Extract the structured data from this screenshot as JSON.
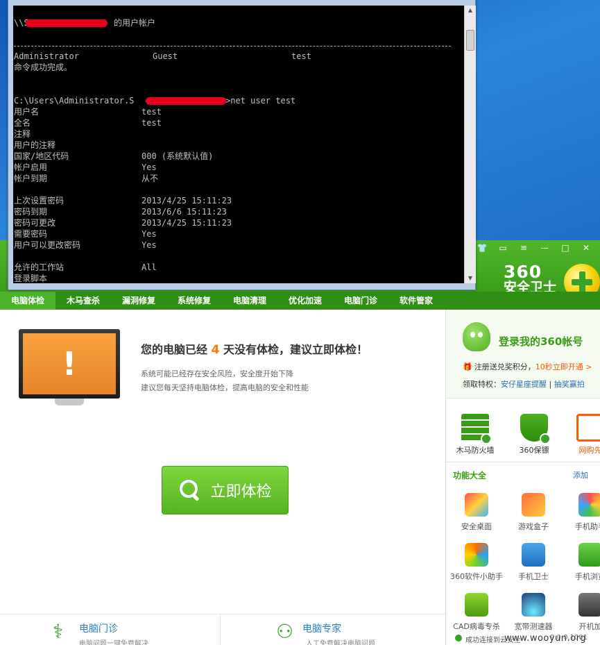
{
  "cmd": {
    "header_user_title": "的用户帐户",
    "header_prefix": "\\\\S",
    "users": [
      "Administrator",
      "Guest",
      "test"
    ],
    "success": "命令成功完成。",
    "prompt_prefix": "C:\\Users\\Administrator.S",
    "prompt_cmd": ">net user test",
    "rows": [
      {
        "label": "用户名",
        "value": "test"
      },
      {
        "label": "全名",
        "value": "test"
      },
      {
        "label": "注释",
        "value": ""
      },
      {
        "label": "用户的注释",
        "value": ""
      },
      {
        "label": "国家/地区代码",
        "value": "000 (系统默认值)"
      },
      {
        "label": "帐户启用",
        "value": "Yes"
      },
      {
        "label": "帐户到期",
        "value": "从不"
      },
      {
        "label": "上次设置密码",
        "value": "2013/4/25 15:11:23"
      },
      {
        "label": "密码到期",
        "value": "2013/6/6 15:11:23"
      },
      {
        "label": "密码可更改",
        "value": "2013/4/25 15:11:23"
      },
      {
        "label": "需要密码",
        "value": "Yes"
      },
      {
        "label": "用户可以更改密码",
        "value": "Yes"
      },
      {
        "label": "允许的工作站",
        "value": "All"
      },
      {
        "label": "登录脚本",
        "value": ""
      }
    ]
  },
  "app360": {
    "brand_num": "360",
    "brand_name": "安全卫士",
    "tabs": [
      "电脑体检",
      "木马查杀",
      "漏洞修复",
      "系统修复",
      "电脑清理",
      "优化加速",
      "电脑门诊",
      "软件管家"
    ],
    "headline_before": "您的电脑已经 ",
    "headline_days": "4",
    "headline_after": " 天没有体检，建议立即体检！",
    "sub1": "系统可能已经存在安全风险，安全度开始下降",
    "sub2": "建议您每天坚持电脑体检，提高电脑的安全和性能",
    "check_button": "立即体检",
    "bottom_left_title": "电脑门诊",
    "bottom_left_sub": "电脑问题一键免费解决",
    "bottom_right_title": "电脑专家",
    "bottom_right_sub": "人工免费解决电脑问题"
  },
  "rpanel": {
    "login_title": "登录我的360帐号",
    "promo_text": "注册送兑奖积分，",
    "promo_red": "10秒立即开通 >",
    "priv_label": "领取特权：",
    "priv_link1": "安仔星座提醒",
    "priv_link2": "抽奖赢拍",
    "features": [
      "木马防火墙",
      "360保镖",
      "网购先"
    ],
    "fn_head": "功能大全",
    "fn_add": "添加",
    "apps": [
      "安全桌面",
      "游戏盒子",
      "手机助手",
      "360软件小助手",
      "手机卫士",
      "手机浏览",
      "CAD病毒专杀",
      "宽带测速器",
      "开机加"
    ],
    "footer_text": "成功连接到云安全",
    "footer_ver": "9.0.0.1001"
  },
  "watermark": "www.wooyun.org"
}
